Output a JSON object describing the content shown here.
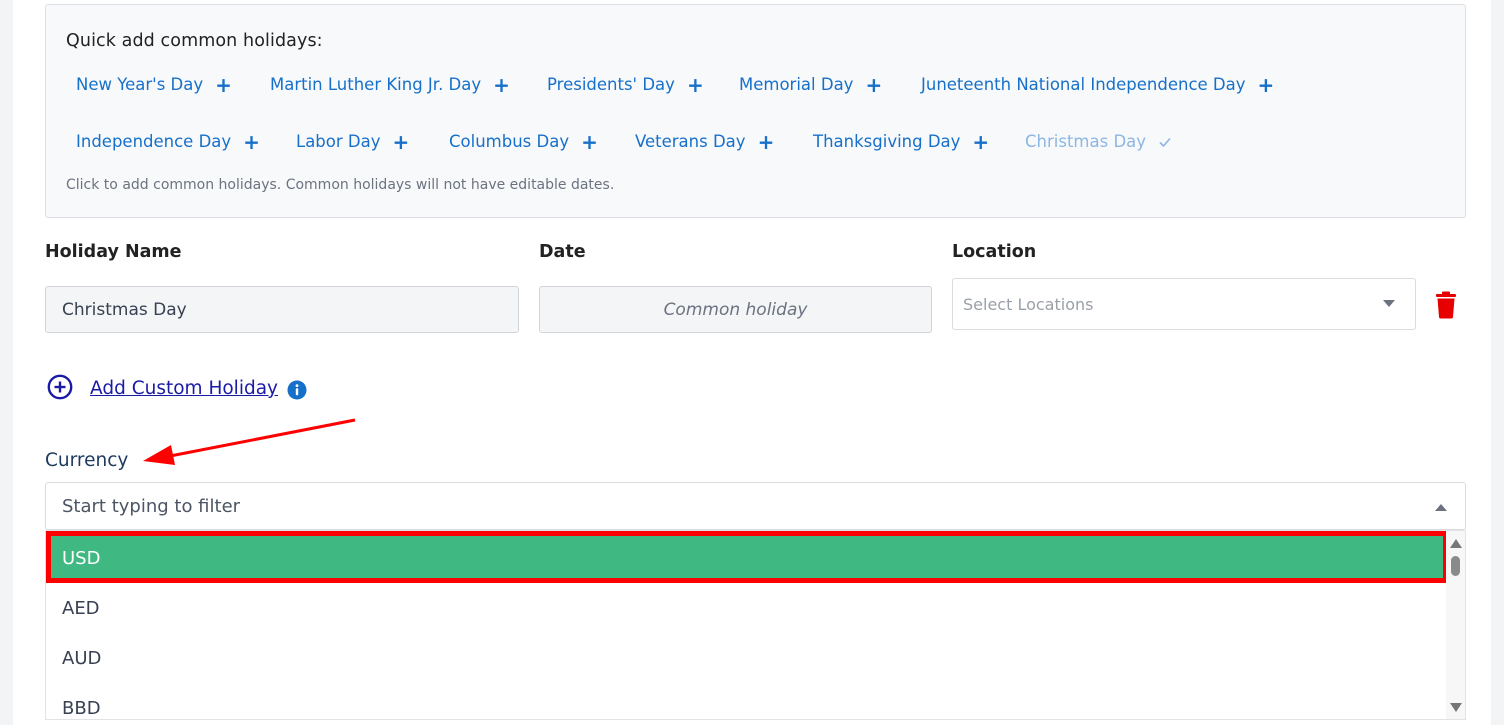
{
  "quick_add": {
    "title": "Quick add common holidays:",
    "chips": [
      {
        "label": "New Year's Day",
        "added": false
      },
      {
        "label": "Martin Luther King Jr. Day",
        "added": false
      },
      {
        "label": "Presidents' Day",
        "added": false
      },
      {
        "label": "Memorial Day",
        "added": false
      },
      {
        "label": "Juneteenth National Independence Day",
        "added": false
      },
      {
        "label": "Independence Day",
        "added": false
      },
      {
        "label": "Labor Day",
        "added": false
      },
      {
        "label": "Columbus Day",
        "added": false
      },
      {
        "label": "Veterans Day",
        "added": false
      },
      {
        "label": "Thanksgiving Day",
        "added": false
      },
      {
        "label": "Christmas Day",
        "added": true
      }
    ],
    "plus_symbol": "+",
    "hint": "Click to add common holidays. Common holidays will not have editable dates."
  },
  "holiday_form": {
    "name_label": "Holiday Name",
    "date_label": "Date",
    "location_label": "Location",
    "rows": [
      {
        "name": "Christmas Day",
        "date": "Common holiday",
        "location_placeholder": "Select Locations"
      }
    ]
  },
  "add_custom": {
    "label": "Add Custom Holiday"
  },
  "currency": {
    "label": "Currency",
    "placeholder": "Start typing to filter",
    "options": [
      "USD",
      "AED",
      "AUD",
      "BBD"
    ],
    "selected": "USD"
  },
  "colors": {
    "link_blue": "#1670c9",
    "selected_green": "#40b882",
    "annotation_red": "#ff0000",
    "delete_red": "#e60000"
  }
}
